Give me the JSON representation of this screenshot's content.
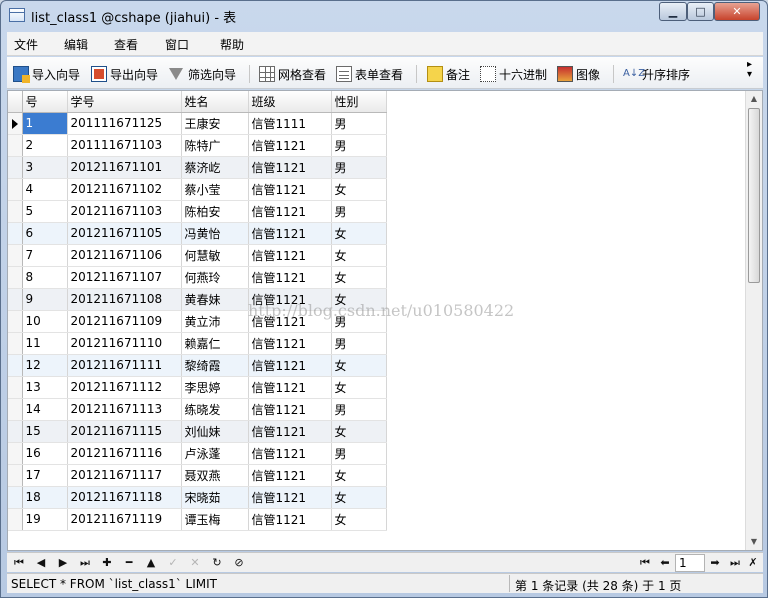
{
  "window": {
    "title": "list_class1 @cshape (jiahui) - 表"
  },
  "menu": [
    "文件",
    "编辑",
    "查看",
    "窗口",
    "帮助"
  ],
  "toolbar": {
    "import": "导入向导",
    "export": "导出向导",
    "filter": "筛选向导",
    "grid_view": "网格查看",
    "form_view": "表单查看",
    "memo": "备注",
    "hex": "十六进制",
    "image": "图像",
    "sort": "升序排序",
    "sort_glyph": "A↓Z"
  },
  "table": {
    "columns": [
      "号",
      "学号",
      "姓名",
      "班级",
      "性别"
    ],
    "rows": [
      [
        "1",
        "201111671125",
        "王康安",
        "信管1111",
        "男"
      ],
      [
        "2",
        "201111671103",
        "陈特广",
        "信管1121",
        "男"
      ],
      [
        "3",
        "201211671101",
        "蔡济屹",
        "信管1121",
        "男"
      ],
      [
        "4",
        "201211671102",
        "蔡小莹",
        "信管1121",
        "女"
      ],
      [
        "5",
        "201211671103",
        "陈柏安",
        "信管1121",
        "男"
      ],
      [
        "6",
        "201211671105",
        "冯黄怡",
        "信管1121",
        "女"
      ],
      [
        "7",
        "201211671106",
        "何慧敏",
        "信管1121",
        "女"
      ],
      [
        "8",
        "201211671107",
        "何燕玲",
        "信管1121",
        "女"
      ],
      [
        "9",
        "201211671108",
        "黄春妹",
        "信管1121",
        "女"
      ],
      [
        "10",
        "201211671109",
        "黄立沛",
        "信管1121",
        "男"
      ],
      [
        "11",
        "201211671110",
        "赖嘉仁",
        "信管1121",
        "男"
      ],
      [
        "12",
        "201211671111",
        "黎绮霞",
        "信管1121",
        "女"
      ],
      [
        "13",
        "201211671112",
        "李思婷",
        "信管1121",
        "女"
      ],
      [
        "14",
        "201211671113",
        "练晓发",
        "信管1121",
        "男"
      ],
      [
        "15",
        "201211671115",
        "刘仙妹",
        "信管1121",
        "女"
      ],
      [
        "16",
        "201211671116",
        "卢泳蓬",
        "信管1121",
        "男"
      ],
      [
        "17",
        "201211671117",
        "聂双燕",
        "信管1121",
        "女"
      ],
      [
        "18",
        "201211671118",
        "宋晓茹",
        "信管1121",
        "女"
      ],
      [
        "19",
        "201211671119",
        "谭玉梅",
        "信管1121",
        "女"
      ]
    ]
  },
  "watermark": "http://blog.csdn.net/u010580422",
  "navigation": {
    "page": "1"
  },
  "status": {
    "sql": "SELECT * FROM `list_class1` LIMIT",
    "record": "第 1 条记录 (共 28 条) 于 1 页"
  }
}
